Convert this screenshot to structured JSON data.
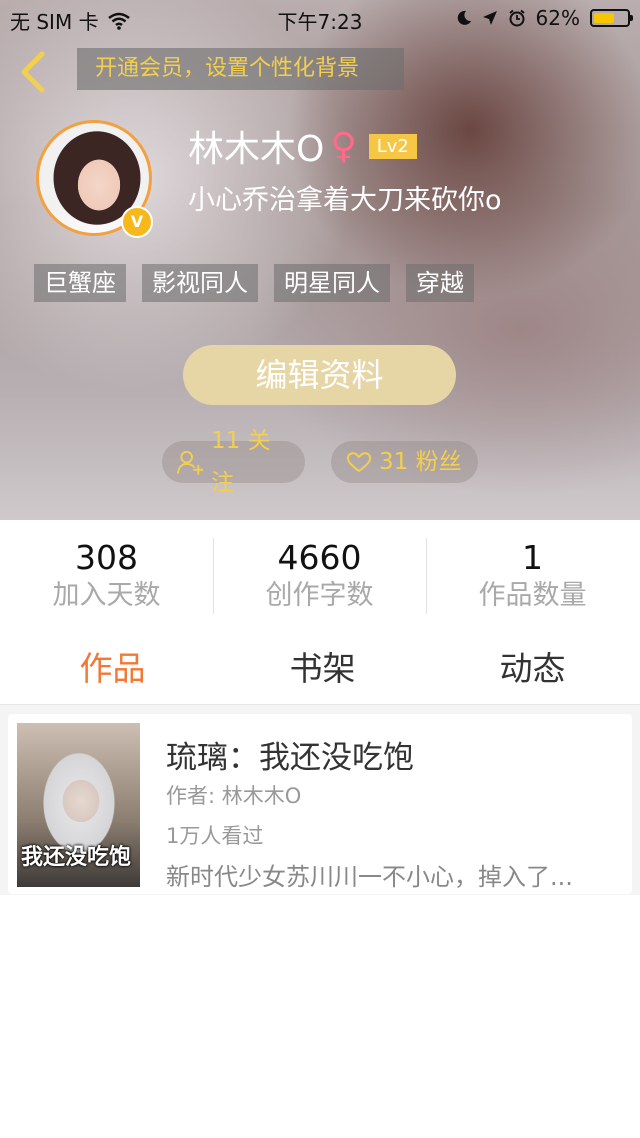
{
  "status_bar": {
    "carrier": "无 SIM 卡",
    "time": "下午7:23",
    "battery": "62%",
    "battery_level": 0.62
  },
  "header": {
    "vip_banner": "开通会员，设置个性化背景"
  },
  "profile": {
    "username": "林木木O",
    "gender_symbol": "♀",
    "level": "Lv2",
    "vip_badge": "V",
    "signature": "小心乔治拿着大刀来砍你o",
    "tags": [
      "巨蟹座",
      "影视同人",
      "明星同人",
      "穿越"
    ],
    "edit_button": "编辑资料",
    "following": "11 关注",
    "followers": "31 粉丝"
  },
  "stats": [
    {
      "value": "308",
      "label": "加入天数"
    },
    {
      "value": "4660",
      "label": "创作字数"
    },
    {
      "value": "1",
      "label": "作品数量"
    }
  ],
  "tabs": [
    {
      "label": "作品",
      "active": true
    },
    {
      "label": "书架",
      "active": false
    },
    {
      "label": "动态",
      "active": false
    }
  ],
  "works": [
    {
      "cover_text": "我还没吃饱",
      "title": "琉璃：我还没吃饱",
      "author": "作者: 林木木O",
      "views": "1万人看过",
      "description": "新时代少女苏川川一不小心，掉入了..."
    }
  ],
  "colors": {
    "accent": "#f17835",
    "vip_gold": "#f3cf4d",
    "edit_button": "#e7d6a5",
    "gender": "#ff6a8c"
  }
}
